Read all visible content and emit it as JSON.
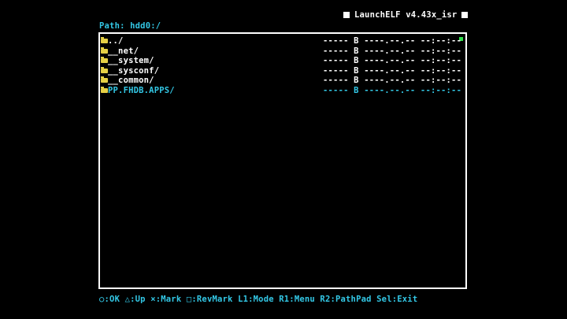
{
  "title": {
    "app_name": "LaunchELF v4.43x_isr"
  },
  "path": {
    "label": "Path: hdd0:/"
  },
  "files": [
    {
      "name": "../",
      "size": "----- B",
      "date": "----.--.-- --:--:--",
      "selected": false
    },
    {
      "name": "__net/",
      "size": "----- B",
      "date": "----.--.-- --:--:--",
      "selected": false
    },
    {
      "name": "__system/",
      "size": "----- B",
      "date": "----.--.-- --:--:--",
      "selected": false
    },
    {
      "name": "__sysconf/",
      "size": "----- B",
      "date": "----.--.-- --:--:--",
      "selected": false
    },
    {
      "name": "__common/",
      "size": "----- B",
      "date": "----.--.-- --:--:--",
      "selected": false
    },
    {
      "name": "PP.FHDB.APPS/",
      "size": "----- B",
      "date": "----.--.-- --:--:--",
      "selected": true
    }
  ],
  "hints": {
    "text": "○:OK △:Up ×:Mark □:RevMark L1:Mode R1:Menu R2:PathPad Sel:Exit"
  },
  "colors": {
    "background": "#000000",
    "text": "#ffffff",
    "accent": "#33c8e6",
    "folder": "#e6d046",
    "scroll_marker": "#2ee04a"
  }
}
